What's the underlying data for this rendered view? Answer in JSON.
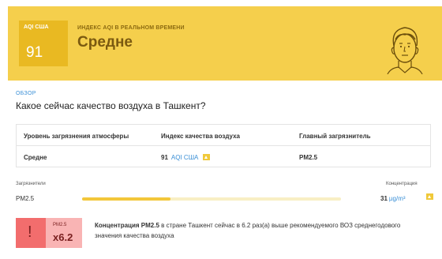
{
  "hero": {
    "aqi_label": "AQI США",
    "aqi_value": "91",
    "kicker": "ИНДЕКС AQI В РЕАЛЬНОМ ВРЕМЕНИ",
    "status": "Средне",
    "icon": "face-icon",
    "color": "#f5cf4c"
  },
  "overview": {
    "label": "ОБЗОР",
    "question": "Какое сейчас качество воздуха в Ташкент?"
  },
  "table": {
    "headers": [
      "Уровень загрязнения атмосферы",
      "Индекс качества воздуха",
      "Главный загрязнитель"
    ],
    "level": "Средне",
    "aqi_value": "91",
    "aqi_unit": "AQI США",
    "main_pollutant": "PM2.5"
  },
  "pollutants": {
    "header_left": "Загрязнители",
    "header_right": "Концентрация",
    "items": [
      {
        "name": "PM2.5",
        "value": "31",
        "unit": "µg/m³",
        "level_fraction": 0.34
      }
    ]
  },
  "alert": {
    "pollutant": "PM2.5",
    "multiplier": "x6.2",
    "text_bold": "Концентрация PM2.5",
    "text_rest": " в стране Ташкент сейчас в 6.2 раз(а) выше рекомендуемого ВОЗ среднегодового значения качества воздуха",
    "color": "#f26d6d"
  }
}
